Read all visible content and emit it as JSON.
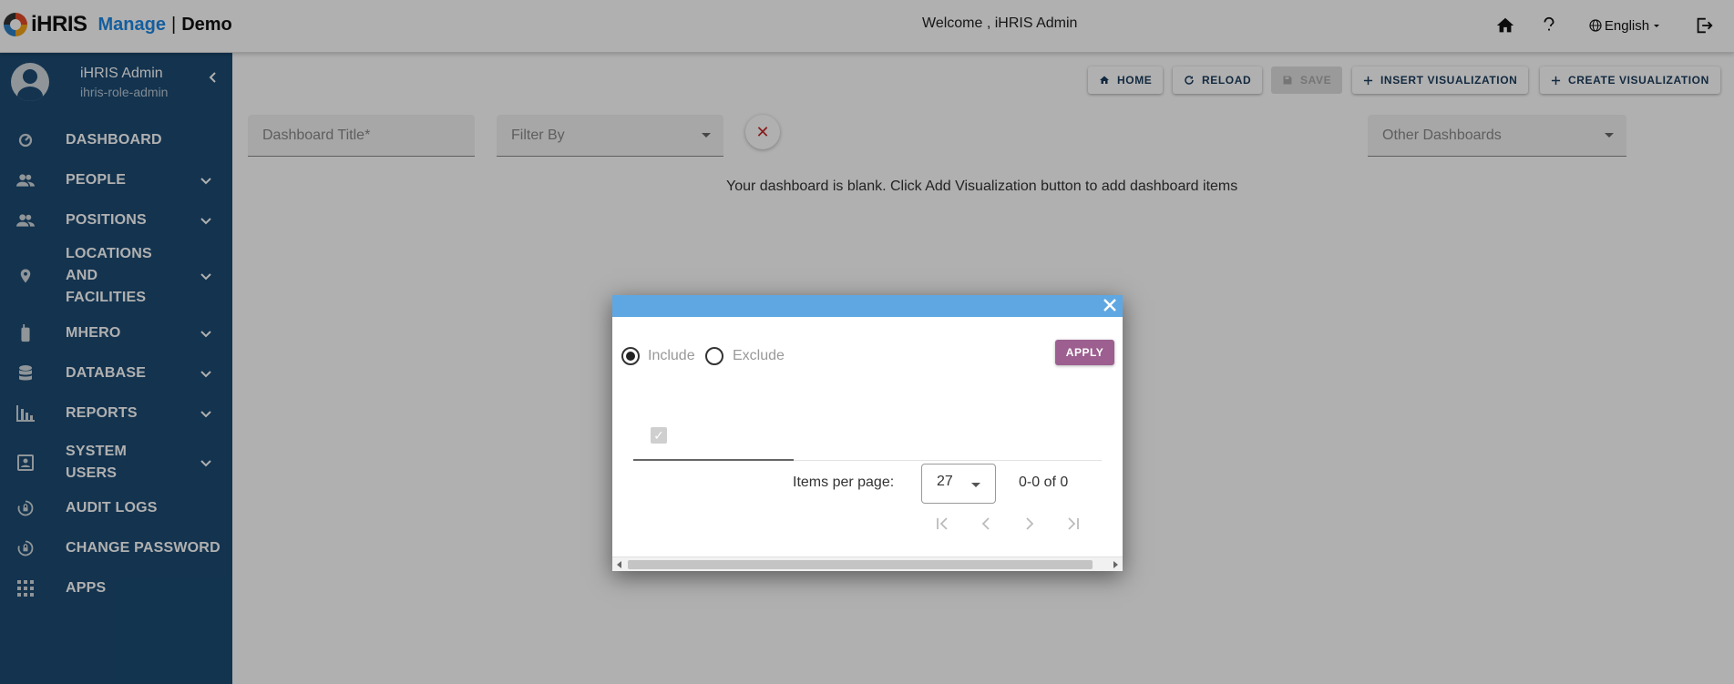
{
  "header": {
    "logo_text": "iHRIS",
    "app_name": "Manage",
    "separator": "|",
    "instance": "Demo",
    "welcome": "Welcome , iHRIS Admin",
    "language": "English"
  },
  "sidebar": {
    "user_name": "iHRIS Admin",
    "user_role": "ihris-role-admin",
    "items": [
      {
        "label": "DASHBOARD",
        "icon": "dashboard-icon",
        "expandable": false
      },
      {
        "label": "PEOPLE",
        "icon": "people-icon",
        "expandable": true
      },
      {
        "label": "POSITIONS",
        "icon": "positions-icon",
        "expandable": true
      },
      {
        "label": "LOCATIONS AND FACILITIES",
        "icon": "location-icon",
        "expandable": true
      },
      {
        "label": "MHERO",
        "icon": "mobile-icon",
        "expandable": true
      },
      {
        "label": "DATABASE",
        "icon": "database-icon",
        "expandable": true
      },
      {
        "label": "REPORTS",
        "icon": "bar-chart-icon",
        "expandable": true
      },
      {
        "label": "SYSTEM USERS",
        "icon": "contact-card-icon",
        "expandable": true
      },
      {
        "label": "AUDIT LOGS",
        "icon": "lock-reset-icon",
        "expandable": false
      },
      {
        "label": "CHANGE PASSWORD",
        "icon": "lock-reset-icon",
        "expandable": false
      },
      {
        "label": "APPS",
        "icon": "apps-grid-icon",
        "expandable": false
      }
    ]
  },
  "toolbar": {
    "home": "HOME",
    "reload": "RELOAD",
    "save": "SAVE",
    "insert": "INSERT VISUALIZATION",
    "create": "CREATE VISUALIZATION"
  },
  "filters": {
    "title_label": "Dashboard Title*",
    "filter_by_label": "Filter By",
    "other_dashboards_label": "Other Dashboards"
  },
  "main": {
    "blank_message": "Your dashboard is blank. Click Add Visualization button to add dashboard items"
  },
  "dialog": {
    "include_label": "Include",
    "exclude_label": "Exclude",
    "selected_mode": "Include",
    "apply_label": "APPLY",
    "items_per_page_label": "Items per page:",
    "items_per_page_value": "27",
    "range_text": "0-0 of 0"
  },
  "colors": {
    "sidebar_bg": "#1c4b73",
    "dialog_header": "#5fa7e2",
    "apply_button": "#9c5f8f",
    "brand_blue": "#1e88e5",
    "clear_icon": "#c62828"
  }
}
